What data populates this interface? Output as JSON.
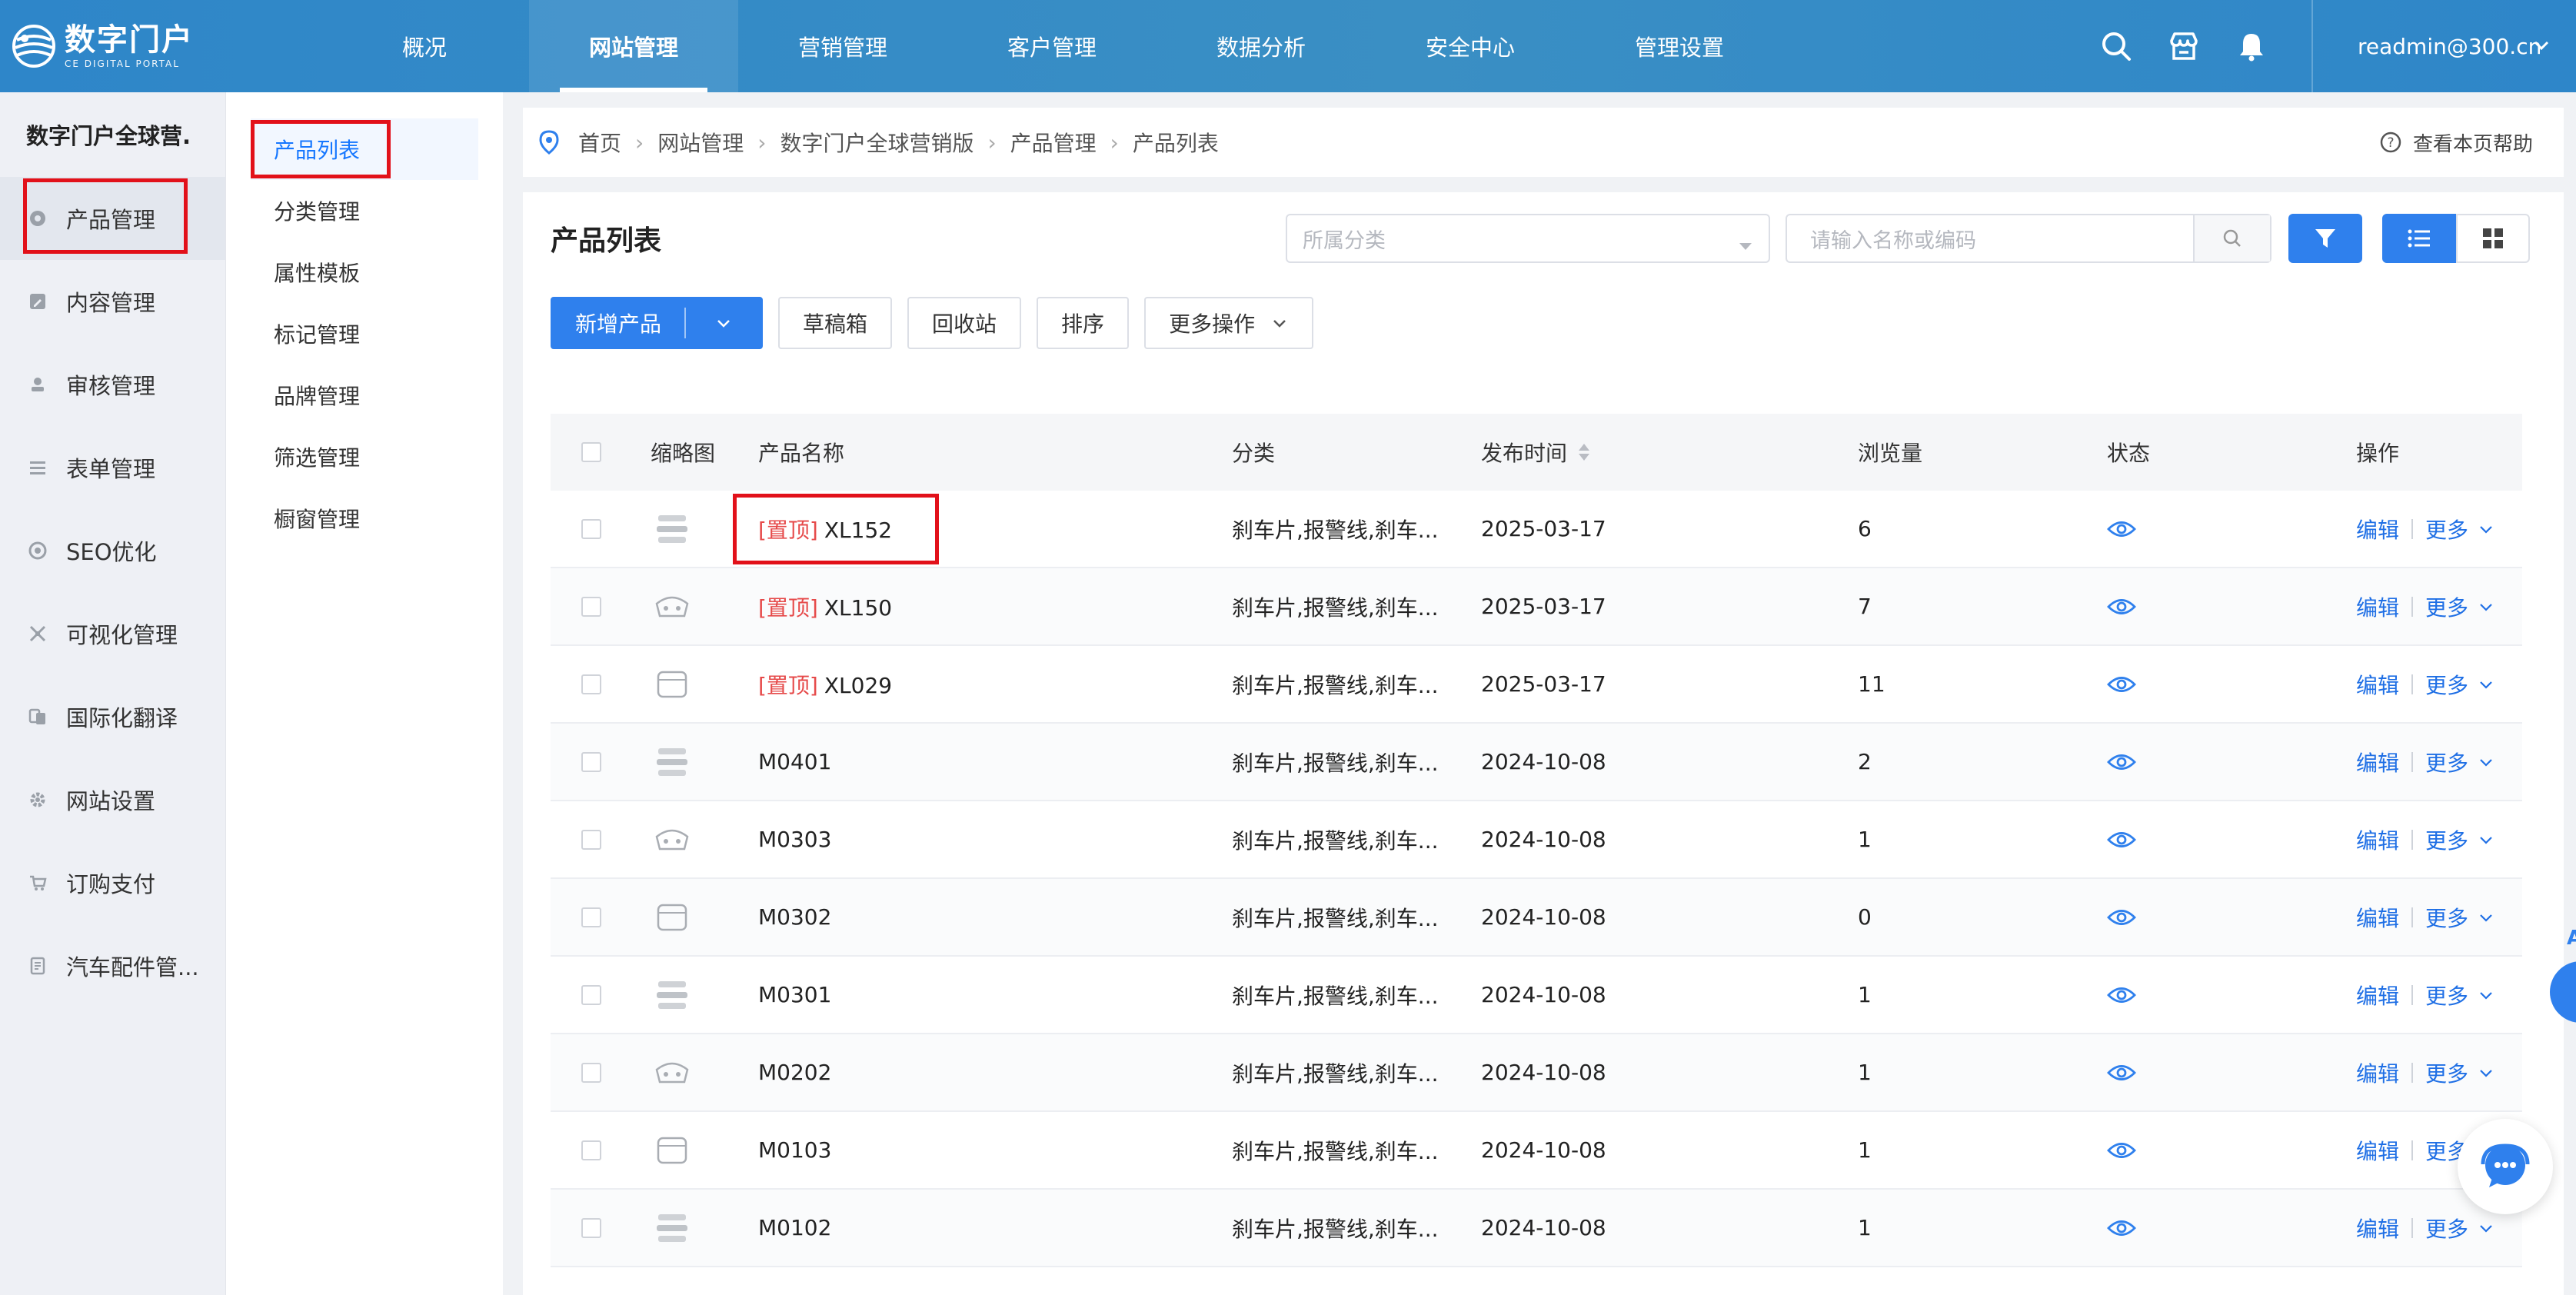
{
  "brand": {
    "name_cn": "数字门户",
    "name_en": "CE DIGITAL PORTAL"
  },
  "topnav": [
    {
      "label": "概况",
      "active": false
    },
    {
      "label": "网站管理",
      "active": true
    },
    {
      "label": "营销管理",
      "active": false
    },
    {
      "label": "客户管理",
      "active": false
    },
    {
      "label": "数据分析",
      "active": false
    },
    {
      "label": "安全中心",
      "active": false
    },
    {
      "label": "管理设置",
      "active": false
    }
  ],
  "header": {
    "icons": [
      "search-icon",
      "store-icon",
      "bell-icon"
    ],
    "user_email": "readmin@300.cn"
  },
  "sidebar": {
    "title": "数字门户全球营.",
    "items": [
      {
        "label": "产品管理",
        "icon": "product-icon",
        "active": true
      },
      {
        "label": "内容管理",
        "icon": "edit-icon",
        "active": false
      },
      {
        "label": "审核管理",
        "icon": "user-review-icon",
        "active": false
      },
      {
        "label": "表单管理",
        "icon": "form-icon",
        "active": false
      },
      {
        "label": "SEO优化",
        "icon": "seo-icon",
        "active": false
      },
      {
        "label": "可视化管理",
        "icon": "visual-icon",
        "active": false
      },
      {
        "label": "国际化翻译",
        "icon": "translate-icon",
        "active": false
      },
      {
        "label": "网站设置",
        "icon": "gear-icon",
        "active": false
      },
      {
        "label": "订购支付",
        "icon": "cart-icon",
        "active": false
      },
      {
        "label": "汽车配件管...",
        "icon": "doc-icon",
        "active": false
      }
    ]
  },
  "subnav": [
    {
      "label": "产品列表",
      "active": true
    },
    {
      "label": "分类管理",
      "active": false
    },
    {
      "label": "属性模板",
      "active": false
    },
    {
      "label": "标记管理",
      "active": false
    },
    {
      "label": "品牌管理",
      "active": false
    },
    {
      "label": "筛选管理",
      "active": false
    },
    {
      "label": "橱窗管理",
      "active": false
    }
  ],
  "breadcrumb": [
    "首页",
    "网站管理",
    "数字门户全球营销版",
    "产品管理",
    "产品列表"
  ],
  "help_label": "查看本页帮助",
  "panel": {
    "title": "产品列表",
    "category_placeholder": "所属分类",
    "search_placeholder": "请输入名称或编码"
  },
  "buttons": {
    "add": "新增产品",
    "drafts": "草稿箱",
    "recycle": "回收站",
    "sort": "排序",
    "more_ops": "更多操作"
  },
  "table": {
    "headers": {
      "thumb": "缩略图",
      "name": "产品名称",
      "category": "分类",
      "date": "发布时间",
      "views": "浏览量",
      "status": "状态",
      "ops": "操作"
    },
    "edit_label": "编辑",
    "more_label": "更多",
    "rows": [
      {
        "pin": "[置顶]",
        "name": "XL152",
        "category": "刹车片,报警线,刹车...",
        "date": "2025-03-17",
        "views": "6"
      },
      {
        "pin": "[置顶]",
        "name": "XL150",
        "category": "刹车片,报警线,刹车...",
        "date": "2025-03-17",
        "views": "7"
      },
      {
        "pin": "[置顶]",
        "name": "XL029",
        "category": "刹车片,报警线,刹车...",
        "date": "2025-03-17",
        "views": "11"
      },
      {
        "pin": "",
        "name": "M0401",
        "category": "刹车片,报警线,刹车...",
        "date": "2024-10-08",
        "views": "2"
      },
      {
        "pin": "",
        "name": "M0303",
        "category": "刹车片,报警线,刹车...",
        "date": "2024-10-08",
        "views": "1"
      },
      {
        "pin": "",
        "name": "M0302",
        "category": "刹车片,报警线,刹车...",
        "date": "2024-10-08",
        "views": "0"
      },
      {
        "pin": "",
        "name": "M0301",
        "category": "刹车片,报警线,刹车...",
        "date": "2024-10-08",
        "views": "1"
      },
      {
        "pin": "",
        "name": "M0202",
        "category": "刹车片,报警线,刹车...",
        "date": "2024-10-08",
        "views": "1"
      },
      {
        "pin": "",
        "name": "M0103",
        "category": "刹车片,报警线,刹车...",
        "date": "2024-10-08",
        "views": "1"
      },
      {
        "pin": "",
        "name": "M0102",
        "category": "刹车片,报警线,刹车...",
        "date": "2024-10-08",
        "views": "1"
      }
    ]
  },
  "colors": {
    "primary": "#2f80ed",
    "header": "#3a8fc4",
    "pin": "#e64a4a",
    "highlight": "#e2111a"
  }
}
